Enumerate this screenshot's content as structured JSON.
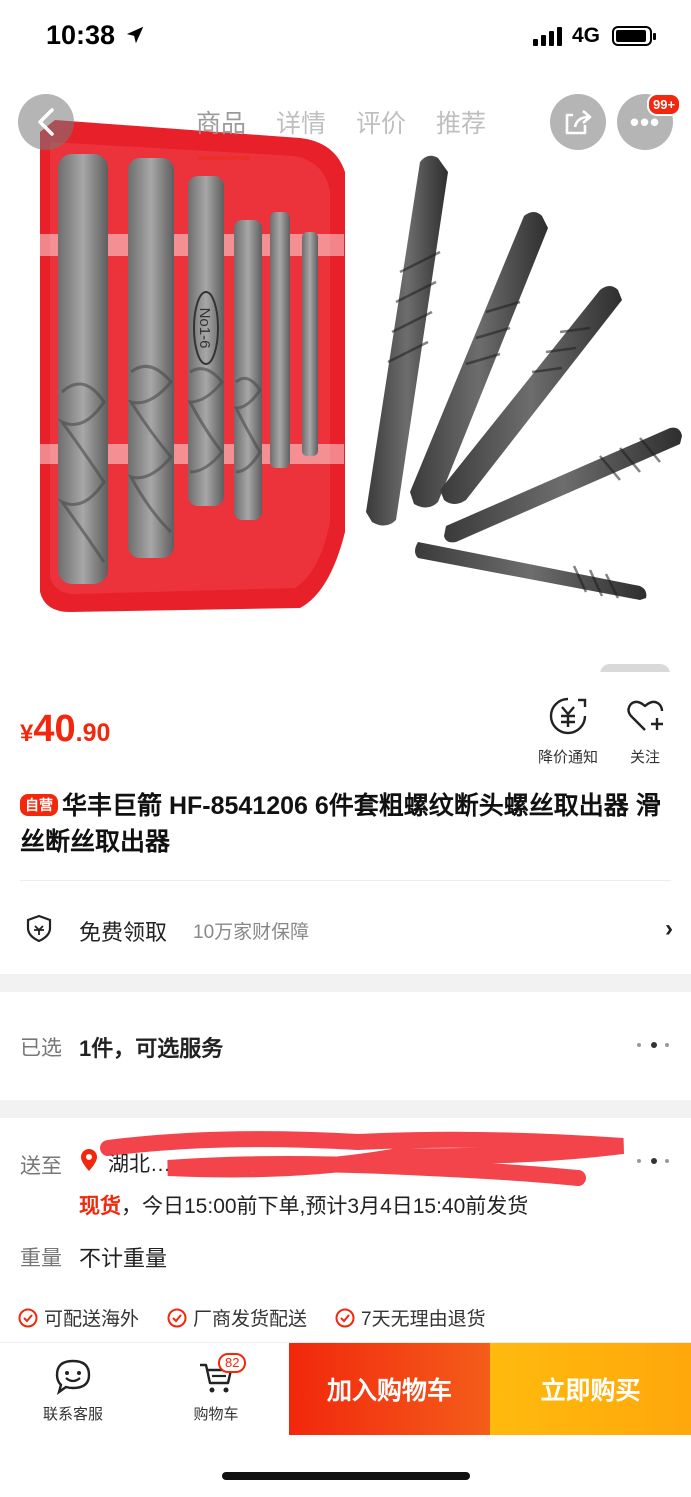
{
  "status_bar": {
    "time": "10:38",
    "network": "4G"
  },
  "header": {
    "tabs": [
      {
        "label": "商品",
        "active": true
      },
      {
        "label": "详情",
        "active": false
      },
      {
        "label": "评价",
        "active": false
      },
      {
        "label": "推荐",
        "active": false
      }
    ],
    "more_badge": "99+"
  },
  "product_image": {
    "box_label": "No1-6"
  },
  "price": {
    "currency": "¥",
    "integer": "40",
    "decimal": ".90"
  },
  "actions": {
    "price_notice_label": "降价通知",
    "follow_label": "关注"
  },
  "title": {
    "tag": "自营",
    "text": "华丰巨箭 HF-8541206 6件套粗螺纹断头螺丝取出器 滑丝断丝取出器"
  },
  "guarantee": {
    "label": "免费领取",
    "sub": "10万家财保障"
  },
  "selected": {
    "label": "已选",
    "value": "1件，可选服务"
  },
  "delivery": {
    "label": "送至",
    "address_visible": "湖北…",
    "stock_status": "现货",
    "stock_detail": "，今日15:00前下单,预计3月4日15:40前发货",
    "weight_label": "重量",
    "weight_value": "不计重量",
    "services": [
      "可配送海外",
      "厂商发货配送",
      "7天无理由退货"
    ]
  },
  "bottom_bar": {
    "service_label": "联系客服",
    "cart_label": "购物车",
    "cart_count": "82",
    "add_to_cart": "加入购物车",
    "buy_now": "立即购买"
  },
  "colors": {
    "accent": "#f2270c",
    "buy": "#ffa70c"
  }
}
